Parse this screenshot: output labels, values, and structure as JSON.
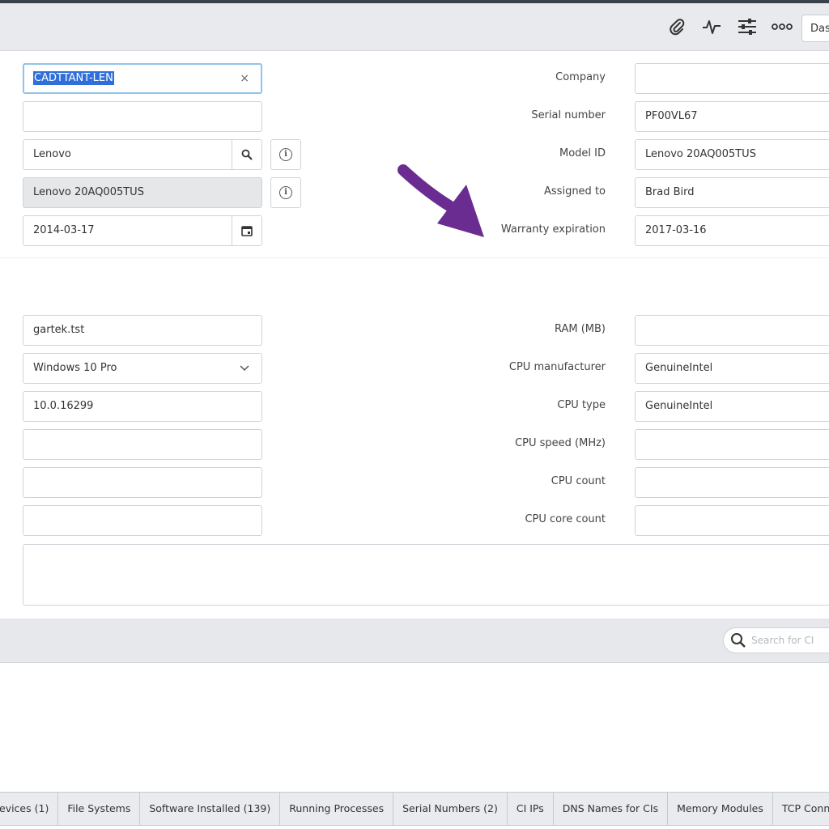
{
  "header": {
    "icons": [
      "paperclip-icon",
      "activity-icon",
      "sliders-icon",
      "more-icon"
    ],
    "right_button_label": "Das"
  },
  "form_top": {
    "left": {
      "name_value": "CADTTANT-LEN",
      "name_clear": "×",
      "empty_field_value": "",
      "manufacturer_value": "Lenovo",
      "model_value": "Lenovo 20AQ005TUS",
      "date_value": "2014-03-17"
    },
    "right": [
      {
        "label": "Company",
        "value": ""
      },
      {
        "label": "Serial number",
        "value": "PF00VL67"
      },
      {
        "label": "Model ID",
        "value": "Lenovo 20AQ005TUS"
      },
      {
        "label": "Assigned to",
        "value": "Brad Bird"
      },
      {
        "label": "Warranty expiration",
        "value": "2017-03-16"
      }
    ]
  },
  "form_bottom": {
    "left": {
      "dns_value": "gartek.tst",
      "os_value": "Windows 10 Pro",
      "os_version_value": "10.0.16299"
    },
    "right": [
      {
        "label": "RAM (MB)",
        "value": ""
      },
      {
        "label": "CPU manufacturer",
        "value": "GenuineIntel"
      },
      {
        "label": "CPU type",
        "value": "GenuineIntel"
      },
      {
        "label": "CPU speed (MHz)",
        "value": ""
      },
      {
        "label": "CPU count",
        "value": ""
      },
      {
        "label": "CPU core count",
        "value": ""
      }
    ]
  },
  "related": {
    "search_placeholder": "Search for CI"
  },
  "tabs": [
    "evices (1)",
    "File Systems",
    "Software Installed (139)",
    "Running Processes",
    "Serial Numbers (2)",
    "CI IPs",
    "DNS Names for CIs",
    "Memory Modules",
    "TCP Conn"
  ],
  "colors": {
    "accent_arrow": "#6a2c91",
    "selection": "#2f6fdb",
    "focus_border": "#8fc3ec"
  }
}
